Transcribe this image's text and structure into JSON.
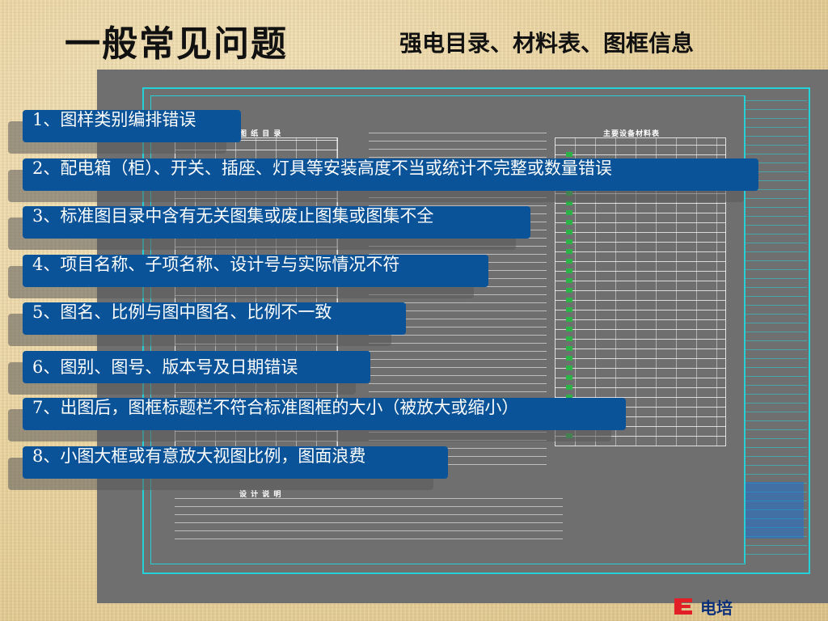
{
  "title": "一般常见问题",
  "subtitle": "强电目录、材料表、图框信息",
  "drawing": {
    "drawing_list_heading": "图 纸 目 录",
    "materials_heading": "主要设备材料表",
    "design_notes_heading": "设 计 说 明"
  },
  "items": [
    {
      "text": "1、图样类别编排错误"
    },
    {
      "text": "2、配电箱（柜）、开关、插座、灯具等安装高度不当或统计不完整或数量错误"
    },
    {
      "text": "3、标准图目录中含有无关图集或废止图集或图集不全"
    },
    {
      "text": "4、项目名称、子项名称、设计号与实际情况不符"
    },
    {
      "text": "5、图名、比例与图中图名、比例不一致"
    },
    {
      "text": "6、图别、图号、版本号及日期错误"
    },
    {
      "text": "7、出图后，图框标题栏不符合标准图框的大小（被放大或缩小）"
    },
    {
      "text": "8、小图大框或有意放大视图比例，图面浪费"
    }
  ],
  "logo": {
    "icon": "dianpei-logo-icon",
    "text": "电培",
    "brand_color": "#e21f26",
    "text_color": "#0a2f7a"
  },
  "colors": {
    "item_bg": "#0a5399",
    "frame_line": "#26d0d8",
    "drawing_bg": "#6f6f6f"
  }
}
